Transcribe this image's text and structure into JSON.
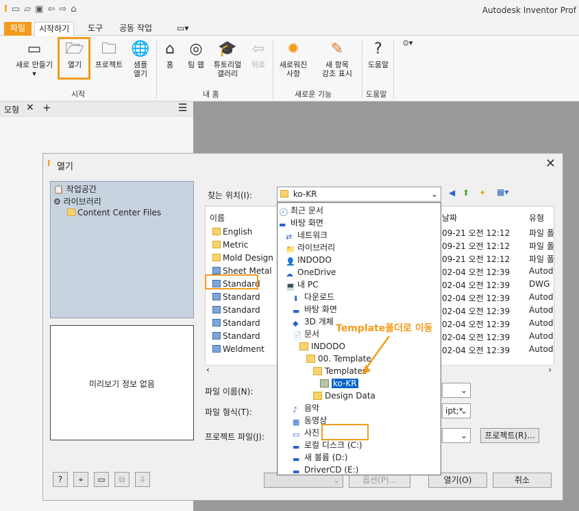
{
  "app": {
    "title": "Autodesk Inventor Prof"
  },
  "tabs": {
    "file": "파일",
    "start": "시작하기",
    "tools": "도구",
    "collab": "공동 작업"
  },
  "ribbon": {
    "new": "새로 만들기",
    "open": "열기",
    "projects": "프로젝트",
    "sample_open_1": "샘플",
    "sample_open_2": "열기",
    "home": "홈",
    "team_web": "팀 웹",
    "tutorial_1": "튜토리얼",
    "tutorial_2": "갤러리",
    "back": "뒤로",
    "whats_new_1": "새로워진",
    "whats_new_2": "사항",
    "highlight_1": "새 항목",
    "highlight_2": "강조 표시",
    "help": "도움말",
    "group_start": "시작",
    "group_myhome": "내 홈",
    "group_newfeatures": "새로운 기능",
    "group_help": "도움말"
  },
  "leftpane": {
    "title": "모형"
  },
  "dialog": {
    "title": "열기",
    "places": [
      "작업공간",
      "라이브러리",
      "Content Center Files"
    ],
    "preview_text": "미리보기 정보 없음",
    "lookin_label": "찾는 위치(I):",
    "lookin_value": "ko-KR",
    "col_name": "이름",
    "col_date": "날짜",
    "col_type": "유형",
    "files": [
      {
        "name": "English",
        "date": "09-21 오전 12:12",
        "type": "파일 폴"
      },
      {
        "name": "Metric",
        "date": "09-21 오전 12:12",
        "type": "파일 폴"
      },
      {
        "name": "Mold Design",
        "date": "09-21 오전 12:12",
        "type": "파일 폴"
      },
      {
        "name": "Sheet Metal",
        "date": "02-04 오전 12:39",
        "type": "Autod"
      },
      {
        "name": "Standard",
        "date": "02-04 오전 12:39",
        "type": "DWG"
      },
      {
        "name": "Standard",
        "date": "02-04 오전 12:39",
        "type": "Autod"
      },
      {
        "name": "Standard",
        "date": "02-04 오전 12:39",
        "type": "Autod"
      },
      {
        "name": "Standard",
        "date": "02-04 오전 12:39",
        "type": "Autod"
      },
      {
        "name": "Standard",
        "date": "02-04 오전 12:39",
        "type": "Autod"
      },
      {
        "name": "Weldment",
        "date": "02-04 오전 12:39",
        "type": "Autod"
      }
    ],
    "filename_label": "파일 이름(N):",
    "filetype_label": "파일 형식(T):",
    "filetype_value": "ipt;*",
    "projectfile_label": "프로젝트 파일(J):",
    "project_button": "프로젝트(R)...",
    "options_button": "옵션(P)...",
    "open_button": "열기(O)",
    "cancel_button": "취소"
  },
  "dropdown": [
    "최근 문서",
    "바탕 화면",
    "네트워크",
    "라이브러리",
    "INDODO",
    "OneDrive",
    "내 PC",
    "다운로드",
    "바탕 화면",
    "3D 개체",
    "문서",
    "INDODO",
    "00. Template",
    "Templates",
    "ko-KR",
    "Design Data",
    "음악",
    "동영상",
    "사진",
    "로컬 디스크 (C:)",
    "새 볼륨 (D:)",
    "DriverCD (E:)"
  ],
  "annotation": "Template폴더로 이동",
  "colors": {
    "accent": "#f29b1c",
    "selection": "#0a64c8"
  }
}
